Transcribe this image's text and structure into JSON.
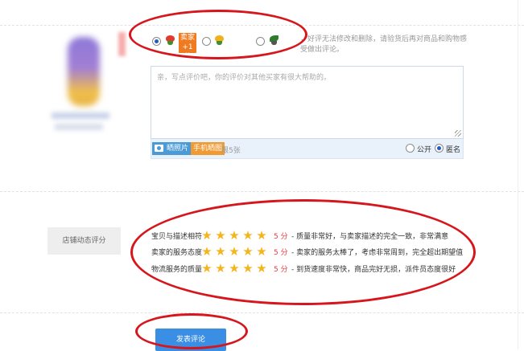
{
  "rating": {
    "options": [
      {
        "id": "good",
        "selected": true,
        "flower_color": "#e23a2e",
        "badge_lines": [
          "卖家",
          "+1分"
        ]
      },
      {
        "id": "neutral",
        "selected": false,
        "flower_color": "#f0b21c",
        "badge_lines": []
      },
      {
        "id": "bad",
        "selected": false,
        "flower_color": "#2e7d2e",
        "badge_lines": []
      }
    ],
    "notice": "，好评无法修改和删除，请验货后再对商品和购物感受做出评论。"
  },
  "review": {
    "placeholder": "亲，写点评价吧，你的评价对其他买家有很大帮助的。",
    "photo_button": "晒照片",
    "mobile_button": "手机晒图",
    "limit_text": "限5张",
    "visibility": {
      "public_label": "公开",
      "anonymous_label": "匿名",
      "selected": "anonymous"
    }
  },
  "shop_rating": {
    "section_label": "店铺动态评分",
    "rows": [
      {
        "name": "宝贝与描述相符",
        "stars": 5,
        "score_text": "5 分",
        "description": "- 质量非常好，与卖家描述的完全一致，非常满意"
      },
      {
        "name": "卖家的服务态度",
        "stars": 5,
        "score_text": "5 分",
        "description": "- 卖家的服务太棒了，考虑非常周到，完全超出期望值"
      },
      {
        "name": "物流服务的质量",
        "stars": 5,
        "score_text": "5 分",
        "description": "- 到货速度非常快，商品完好无损，派件员态度很好"
      }
    ]
  },
  "submit_button": "发表评论",
  "colors": {
    "annotation_red": "#d6161c",
    "accent_blue": "#3a8ee4",
    "star": "#f5b41b",
    "score_red": "#e4393c"
  }
}
